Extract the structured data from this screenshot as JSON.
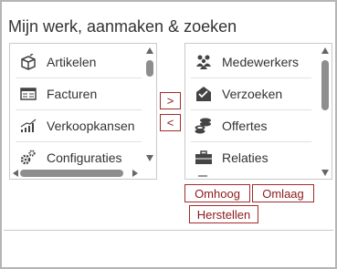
{
  "panel": {
    "title": "Mijn werk, aanmaken & zoeken"
  },
  "left_list": {
    "items": [
      {
        "label": "Artikelen",
        "icon": "box-icon"
      },
      {
        "label": "Facturen",
        "icon": "invoice-icon"
      },
      {
        "label": "Verkoopkansen",
        "icon": "chart-icon"
      },
      {
        "label": "Configuraties",
        "icon": "gears-icon"
      }
    ]
  },
  "right_list": {
    "items": [
      {
        "label": "Medewerkers",
        "icon": "people-icon"
      },
      {
        "label": "Verzoeken",
        "icon": "envelope-icon"
      },
      {
        "label": "Offertes",
        "icon": "coins-icon"
      },
      {
        "label": "Relaties",
        "icon": "briefcase-icon"
      }
    ]
  },
  "transfer": {
    "add_label": ">",
    "remove_label": "<"
  },
  "actions": {
    "up_label": "Omhoog",
    "down_label": "Omlaag",
    "reset_label": "Herstellen"
  },
  "colors": {
    "accent": "#a52a2a",
    "border": "#c9c9c9",
    "scrollbar": "#8e8e8e"
  }
}
